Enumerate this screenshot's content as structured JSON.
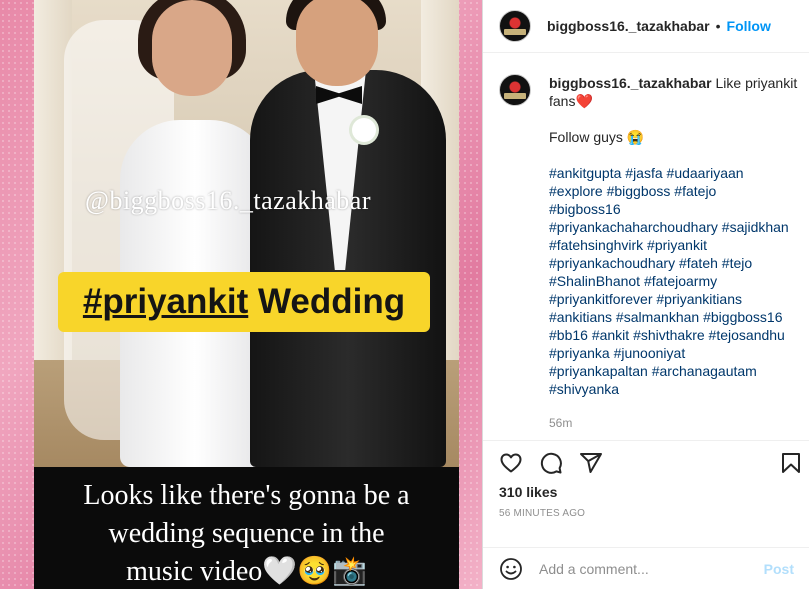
{
  "post_image": {
    "watermark": "@biggboss16._tazakhabar",
    "headline_tag": "#priyankit",
    "headline_rest": " Wedding",
    "caption_lines": [
      "Looks like there's gonna be a",
      "wedding sequence in the",
      "music video🤍🥹📸"
    ]
  },
  "header": {
    "username": "biggboss16._tazakhabar",
    "separator": "•",
    "follow_label": "Follow"
  },
  "caption": {
    "username": "biggboss16._tazakhabar",
    "text": " Like priyankit fans❤️",
    "line2": "Follow guys 😭",
    "hashtag_lines": [
      "#ankitgupta #jasfa #udaariyaan",
      "#explore #biggboss #fatejo",
      "#bigboss16",
      "#priyankachaharchoudhary #sajidkhan",
      "#fatehsinghvirk #priyankit",
      "#priyankachoudhary #fateh #tejo",
      "#ShalinBhanot #fatejoarmy",
      "#priyankitforever #priyankitians",
      "#ankitians #salmankhan #biggboss16",
      "#bb16 #ankit #shivthakre #tejosandhu",
      "#priyanka #junooniyat",
      "#priyankapaltan #archanagautam",
      "#shivyanka"
    ],
    "time": "56m"
  },
  "actions": {
    "likes": "310 likes",
    "time_ago": "56 MINUTES AGO"
  },
  "comment_bar": {
    "placeholder": "Add a comment...",
    "post_label": "Post"
  },
  "colors": {
    "link_blue": "#0095f6",
    "hashtag": "#00376b",
    "headline_bg": "#f8d52a"
  }
}
